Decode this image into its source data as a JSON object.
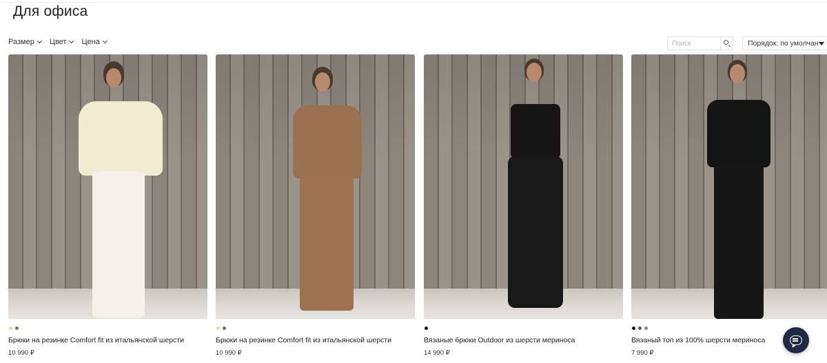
{
  "page": {
    "title": "Для офиса"
  },
  "filters": [
    {
      "label": "Размер"
    },
    {
      "label": "Цвет"
    },
    {
      "label": "Цена"
    }
  ],
  "search": {
    "placeholder": "Поиск"
  },
  "sort": {
    "label": "Порядок: по умолчан"
  },
  "products": [
    {
      "name": "Брюки на резинке Comfort fit из итальянской шерсти",
      "price": "10 990 ₽",
      "swatches": [
        "#d9d2c2",
        "#8a6a4a"
      ],
      "top_color": "#f1ebd2",
      "bottom_color": "#f4f1ea",
      "icon": "product-photo-icon"
    },
    {
      "name": "Брюки на резинке Comfort fit из итальянской шерсти",
      "price": "10 990 ₽",
      "swatches": [
        "#d9d2c2",
        "#8a6a4a"
      ],
      "top_color": "#9a7050",
      "bottom_color": "#9c7250",
      "icon": "product-photo-icon"
    },
    {
      "name": "Вязаные брюки Outdoor из шерсти мериноса",
      "price": "14 990 ₽",
      "swatches": [
        "#111111"
      ],
      "top_color": "#151515",
      "bottom_color": "#181818",
      "icon": "product-photo-icon"
    },
    {
      "name": "Вязаный топ из 100% шерсти мериноса",
      "price": "7 990 ₽",
      "swatches": [
        "#111111",
        "#555555",
        "#8a8a8a"
      ],
      "top_color": "#141414",
      "bottom_color": "#161616",
      "icon": "product-photo-icon"
    }
  ],
  "chat": {
    "icon": "chat-icon"
  }
}
